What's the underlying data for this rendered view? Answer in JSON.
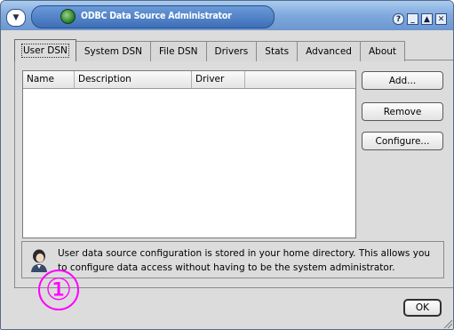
{
  "window": {
    "title": "ODBC Data Source Administrator",
    "title_buttons": [
      "?",
      "_",
      "▲",
      "✕"
    ]
  },
  "tabs": [
    {
      "label": "User DSN",
      "active": true
    },
    {
      "label": "System DSN",
      "active": false
    },
    {
      "label": "File DSN",
      "active": false
    },
    {
      "label": "Drivers",
      "active": false
    },
    {
      "label": "Stats",
      "active": false
    },
    {
      "label": "Advanced",
      "active": false
    },
    {
      "label": "About",
      "active": false
    }
  ],
  "list": {
    "columns": [
      "Name",
      "Description",
      "Driver",
      ""
    ],
    "rows": []
  },
  "buttons": {
    "add": "Add...",
    "remove": "Remove",
    "configure": "Configure...",
    "ok": "OK"
  },
  "info": {
    "text": "User data source configuration is stored in your home directory. This allows you to configure data access without having to be the system administrator."
  },
  "callout": {
    "label": "①",
    "color": "#ff00ff"
  },
  "colors": {
    "titlebar": "#6b97d0",
    "window_bg": "#dcdcdc"
  }
}
